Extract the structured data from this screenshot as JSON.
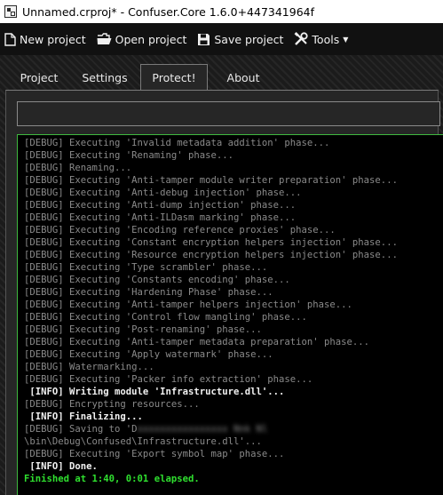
{
  "window": {
    "title": "Unnamed.crproj* - Confuser.Core 1.6.0+447341964f"
  },
  "toolbar": {
    "new_project": "New project",
    "open_project": "Open project",
    "save_project": "Save project",
    "tools": "Tools"
  },
  "tabs": [
    "Project",
    "Settings",
    "Protect!",
    "About"
  ],
  "active_tab": "Protect!",
  "progress": {
    "value": 0
  },
  "log": [
    {
      "level": "debug",
      "text": "[DEBUG] Executing 'Invalid metadata addition' phase..."
    },
    {
      "level": "debug",
      "text": "[DEBUG] Executing 'Renaming' phase..."
    },
    {
      "level": "debug",
      "text": "[DEBUG] Renaming..."
    },
    {
      "level": "debug",
      "text": "[DEBUG] Executing 'Anti-tamper module writer preparation' phase..."
    },
    {
      "level": "debug",
      "text": "[DEBUG] Executing 'Anti-debug injection' phase..."
    },
    {
      "level": "debug",
      "text": "[DEBUG] Executing 'Anti-dump injection' phase..."
    },
    {
      "level": "debug",
      "text": "[DEBUG] Executing 'Anti-ILDasm marking' phase..."
    },
    {
      "level": "debug",
      "text": "[DEBUG] Executing 'Encoding reference proxies' phase..."
    },
    {
      "level": "debug",
      "text": "[DEBUG] Executing 'Constant encryption helpers injection' phase..."
    },
    {
      "level": "debug",
      "text": "[DEBUG] Executing 'Resource encryption helpers injection' phase..."
    },
    {
      "level": "debug",
      "text": "[DEBUG] Executing 'Type scrambler' phase..."
    },
    {
      "level": "debug",
      "text": "[DEBUG] Executing 'Constants encoding' phase..."
    },
    {
      "level": "debug",
      "text": "[DEBUG] Executing 'Hardening Phase' phase..."
    },
    {
      "level": "debug",
      "text": "[DEBUG] Executing 'Anti-tamper helpers injection' phase..."
    },
    {
      "level": "debug",
      "text": "[DEBUG] Executing 'Control flow mangling' phase..."
    },
    {
      "level": "debug",
      "text": "[DEBUG] Executing 'Post-renaming' phase..."
    },
    {
      "level": "debug",
      "text": "[DEBUG] Executing 'Anti-tamper metadata preparation' phase..."
    },
    {
      "level": "debug",
      "text": "[DEBUG] Executing 'Apply watermark' phase..."
    },
    {
      "level": "debug",
      "text": "[DEBUG] Watermarking..."
    },
    {
      "level": "debug",
      "text": "[DEBUG] Executing 'Packer info extraction' phase..."
    },
    {
      "level": "info",
      "text": " [INFO] Writing module 'Infrastructure.dll'..."
    },
    {
      "level": "debug",
      "text": "[DEBUG] Encrypting resources..."
    },
    {
      "level": "info",
      "text": " [INFO] Finalizing..."
    },
    {
      "level": "debug",
      "text": "[DEBUG] Saving to 'D",
      "blurred": "xxxxxxxxxxxxxxxx Nnk Nl"
    },
    {
      "level": "debug",
      "text": "\\bin\\Debug\\Confused\\Infrastructure.dll'..."
    },
    {
      "level": "debug",
      "text": "[DEBUG] Executing 'Export symbol map' phase..."
    },
    {
      "level": "info",
      "text": " [INFO] Done."
    },
    {
      "level": "finish",
      "text": "Finished at 1:40, 0:01 elapsed."
    }
  ]
}
